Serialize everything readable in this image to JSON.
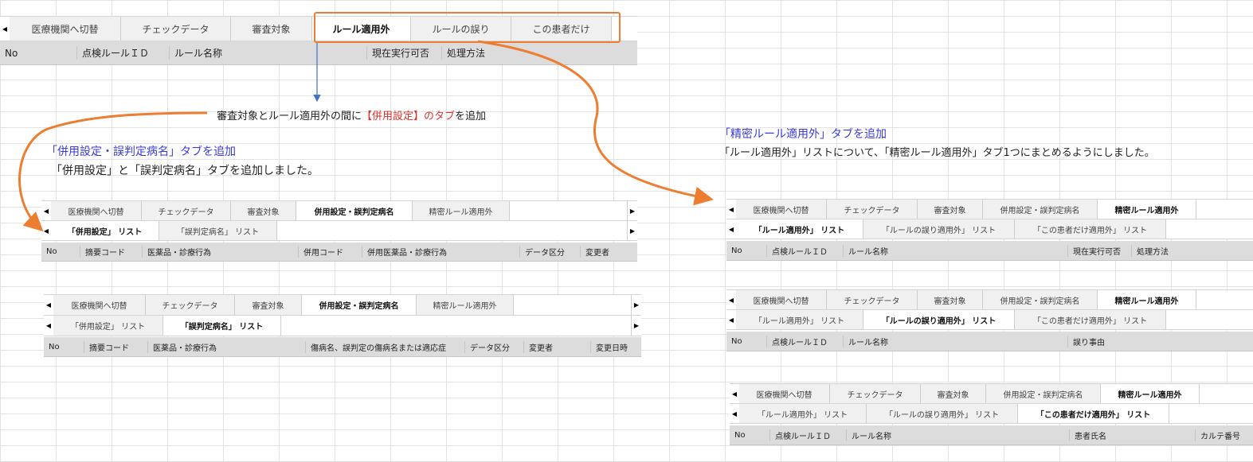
{
  "top_tabs": {
    "tabs": [
      "医療機関へ切替",
      "チェックデータ",
      "審査対象",
      "ルール適用外",
      "ルールの誤り",
      "この患者だけ"
    ],
    "columns": [
      "No",
      "点検ルールＩＤ",
      "ルール名称",
      "現在実行可否",
      "処理方法"
    ]
  },
  "annotations": {
    "note1_pre": "審査対象とルール適用外の間に",
    "note1_red": "【併用設定】のタブ",
    "note1_post": "を追加",
    "left_title": "「併用設定・誤判定病名」タブを追加",
    "left_desc": "「併用設定」と「誤判定病名」タブを追加しました。",
    "right_title": "「精密ルール適用外」タブを追加",
    "right_desc": "「ルール適用外」リストについて、「精密ルール適用外」タブ1つにまとめるようにしました。"
  },
  "left_panel1": {
    "tabs": [
      "医療機関へ切替",
      "チェックデータ",
      "審査対象",
      "併用設定・誤判定病名",
      "精密ルール適用外"
    ],
    "subtabs": [
      "「併用設定」 リスト",
      "「誤判定病名」 リスト"
    ],
    "columns": [
      "No",
      "摘要コード",
      "医薬品・診療行為",
      "併用コード",
      "併用医薬品・診療行為",
      "データ区分",
      "変更者"
    ]
  },
  "left_panel2": {
    "tabs": [
      "医療機関へ切替",
      "チェックデータ",
      "審査対象",
      "併用設定・誤判定病名",
      "精密ルール適用外"
    ],
    "subtabs": [
      "「併用設定」 リスト",
      "「誤判定病名」 リスト"
    ],
    "columns": [
      "No",
      "摘要コード",
      "医薬品・診療行為",
      "傷病名、誤判定の傷病名または適応症",
      "データ区分",
      "変更者",
      "変更日時"
    ]
  },
  "right_panel1": {
    "tabs": [
      "医療機関へ切替",
      "チェックデータ",
      "審査対象",
      "併用設定・誤判定病名",
      "精密ルール適用外"
    ],
    "subtabs": [
      "「ルール適用外」 リスト",
      "「ルールの誤り適用外」 リスト",
      "「この患者だけ適用外」 リスト"
    ],
    "columns": [
      "No",
      "点検ルールＩＤ",
      "ルール名称",
      "現在実行可否",
      "処理方法"
    ]
  },
  "right_panel2": {
    "tabs": [
      "医療機関へ切替",
      "チェックデータ",
      "審査対象",
      "併用設定・誤判定病名",
      "精密ルール適用外"
    ],
    "subtabs": [
      "「ルール適用外」 リスト",
      "「ルールの誤り適用外」 リスト",
      "「この患者だけ適用外」 リスト"
    ],
    "columns": [
      "No",
      "点検ルールＩＤ",
      "ルール名称",
      "誤り事由"
    ]
  },
  "right_panel3": {
    "tabs": [
      "医療機関へ切替",
      "チェックデータ",
      "審査対象",
      "併用設定・誤判定病名",
      "精密ルール適用外"
    ],
    "subtabs": [
      "「ルール適用外」 リスト",
      "「ルールの誤り適用外」 リスト",
      "「この患者だけ適用外」 リスト"
    ],
    "columns": [
      "No",
      "点検ルールＩＤ",
      "ルール名称",
      "患者氏名",
      "カルテ番号"
    ]
  },
  "colors": {
    "highlight": "#ed7d31",
    "arrow_blue": "#4472c4",
    "note_blue": "#3a3ad8",
    "note_red": "#e0302a"
  }
}
